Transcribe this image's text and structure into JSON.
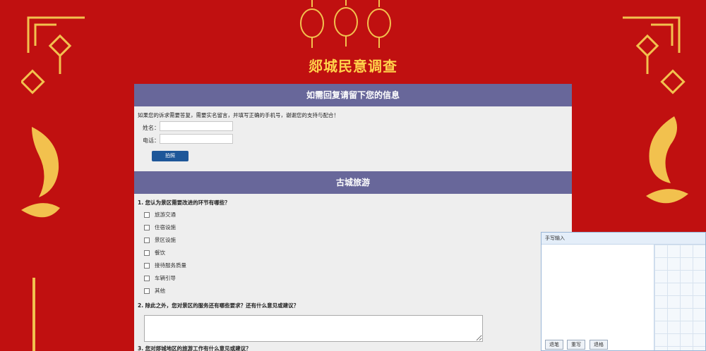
{
  "page": {
    "title": "郯城民意调查"
  },
  "contact": {
    "header": "如需回复请留下您的信息",
    "notice": "如果您的诉求需要答复，需要实名留言，并填写正确的手机号，谢谢您的支持与配合！",
    "name_label": "姓名：",
    "phone_label": "电话：",
    "name_value": "",
    "phone_value": "",
    "photo_button": "拍照"
  },
  "survey": {
    "header": "古城旅游",
    "q1": {
      "title": "1. 您认为景区需要改进的环节有哪些？",
      "options": [
        "旅游交通",
        "住宿设施",
        "景区设施",
        "餐饮",
        "接待服务质量",
        "车辆引导",
        "其他"
      ]
    },
    "q2": {
      "title": "2. 除此之外，您对景区的服务还有哪些要求？还有什么意见或建议？",
      "value": ""
    },
    "q3": {
      "title": "3. 您对郯城地区的旅游工作有什么意见或建议？"
    }
  },
  "handwriting": {
    "title": "手写输入",
    "backspace": "退笔",
    "rewrite": "重写",
    "delete": "退格"
  },
  "colors": {
    "background": "#c01010",
    "gold": "#ffd24a",
    "header": "#68679a",
    "button": "#1e5799"
  },
  "icons": [
    "lantern-icon",
    "chinese-knot-icon",
    "koi-fish-icon"
  ]
}
